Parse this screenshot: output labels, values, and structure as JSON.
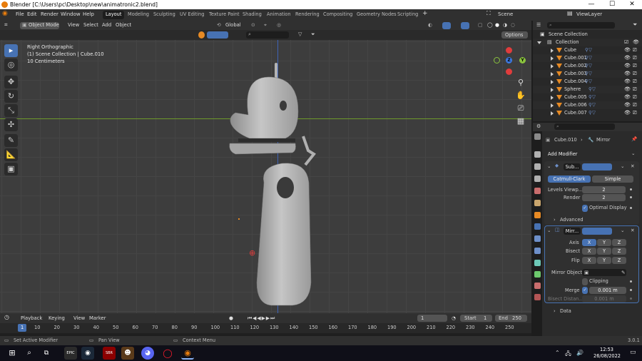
{
  "window": {
    "title": "Blender [C:\\Users\\pc\\Desktop\\new\\animatronic2.blend]",
    "minimize": "—",
    "maximize": "☐",
    "close": "✕"
  },
  "menu": {
    "items": [
      "File",
      "Edit",
      "Render",
      "Window",
      "Help"
    ],
    "workspaces": [
      "Layout",
      "Modeling",
      "Sculpting",
      "UV Editing",
      "Texture Paint",
      "Shading",
      "Animation",
      "Rendering",
      "Compositing",
      "Geometry Nodes",
      "Scripting"
    ],
    "add_tab": "+",
    "scene": "Scene",
    "view_layer": "ViewLayer"
  },
  "viewport_header": {
    "mode": "Object Mode",
    "items": [
      "View",
      "Select",
      "Add",
      "Object"
    ],
    "orientation": "Global",
    "options": "Options"
  },
  "viewport": {
    "view_name": "Right Orthographic",
    "collection": "(1) Scene Collection | Cube.010",
    "scale": "10 Centimeters",
    "gizmo": {
      "z": "Z",
      "y": "Y"
    }
  },
  "timeline": {
    "items": [
      "Playback",
      "Keying",
      "View",
      "Marker"
    ],
    "current_frame": "1",
    "start_label": "Start",
    "start": "1",
    "end_label": "End",
    "end": "250",
    "ticks": [
      "1",
      "10",
      "20",
      "30",
      "40",
      "50",
      "60",
      "70",
      "80",
      "90",
      "100",
      "110",
      "120",
      "130",
      "140",
      "150",
      "160",
      "170",
      "180",
      "190",
      "200",
      "210",
      "220",
      "230",
      "240",
      "250"
    ]
  },
  "statusbar": {
    "left": "Set Active Modifier",
    "middle": "Pan View",
    "right": "Context Menu",
    "version": "3.0.1"
  },
  "outliner": {
    "root": "Scene Collection",
    "collection": "Collection",
    "items": [
      "Cube",
      "Cube.001",
      "Cube.002",
      "Cube.003",
      "Cube.004",
      "Sphere",
      "Cube.005",
      "Cube.006",
      "Cube.007"
    ]
  },
  "properties": {
    "object": "Cube.010",
    "modifier_context": "Mirror",
    "add_modifier": "Add Modifier",
    "subsurf": {
      "name": "Sub...",
      "catmull": "Catmull-Clark",
      "simple": "Simple",
      "levels_label": "Levels Viewp...",
      "levels": "2",
      "render_label": "Render",
      "render": "2",
      "optimal": "Optimal Display",
      "advanced": "Advanced"
    },
    "mirror": {
      "name": "Mirr...",
      "axis_label": "Axis",
      "bisect_label": "Bisect",
      "flip_label": "Flip",
      "x": "X",
      "y": "Y",
      "z": "Z",
      "mirror_object": "Mirror Object",
      "clipping": "Clipping",
      "merge_label": "Merge",
      "merge": "0.001 m",
      "bisect_distance_label": "Bisect Distan...",
      "bisect_distance": "0.001 m",
      "data": "Data"
    }
  },
  "taskbar": {
    "time": "12:53",
    "date": "26/08/2022",
    "apps": [
      "EPIC",
      "Steam",
      "SBR",
      "Game",
      "Discord",
      "Opera",
      "Blender"
    ]
  },
  "colors": {
    "accent": "#4772b3",
    "x_axis": "#e03c3c",
    "y_axis": "#8ac33e",
    "z_axis": "#3c78e0",
    "object_orange": "#e78a24"
  }
}
